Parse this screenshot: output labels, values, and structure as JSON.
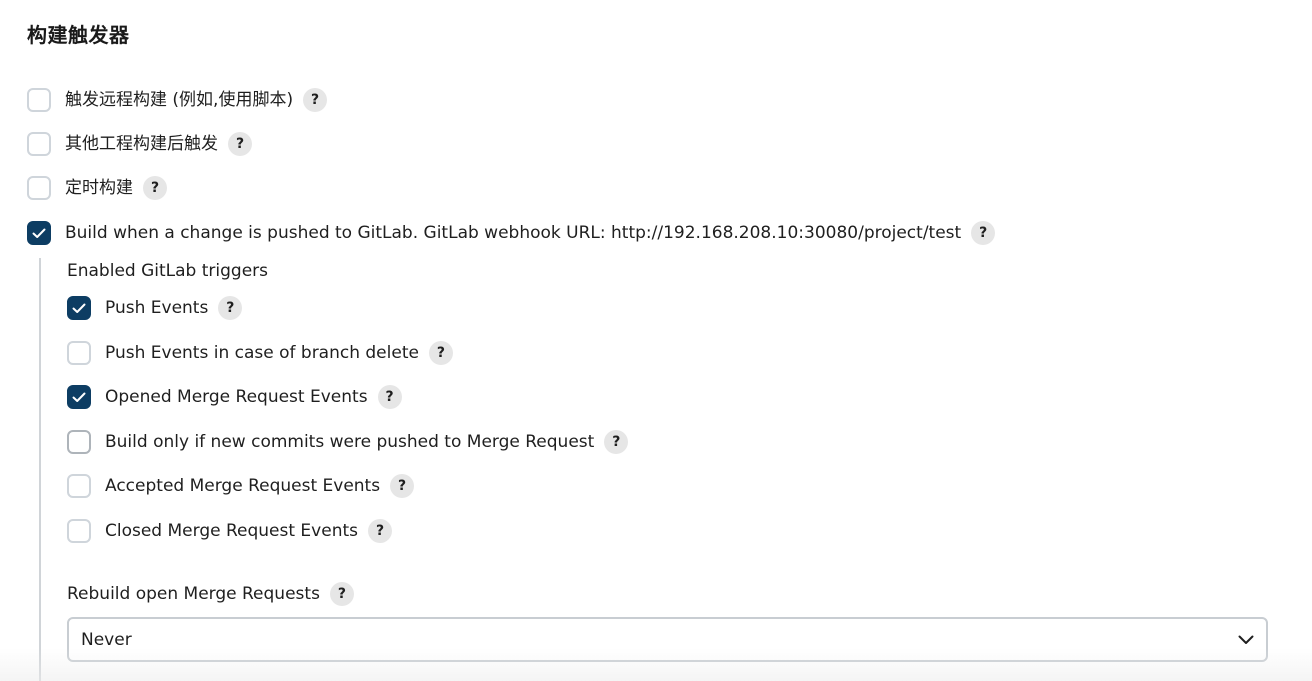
{
  "section": {
    "title": "构建触发器"
  },
  "triggers": [
    {
      "label": "触发远程构建 (例如,使用脚本)",
      "checked": false,
      "help": "?"
    },
    {
      "label": "其他工程构建后触发",
      "checked": false,
      "help": "?"
    },
    {
      "label": "定时构建",
      "checked": false,
      "help": "?"
    },
    {
      "label": "Build when a change is pushed to GitLab. GitLab webhook URL: http://192.168.208.10:30080/project/test",
      "checked": true,
      "help": "?"
    }
  ],
  "gitlab": {
    "heading": "Enabled GitLab triggers",
    "options": [
      {
        "label": "Push Events",
        "checked": true,
        "help": "?"
      },
      {
        "label": "Push Events in case of branch delete",
        "checked": false,
        "help": "?"
      },
      {
        "label": "Opened Merge Request Events",
        "checked": true,
        "help": "?"
      },
      {
        "label": "Build only if new commits were pushed to Merge Request",
        "checked": false,
        "help": "?"
      },
      {
        "label": "Accepted Merge Request Events",
        "checked": false,
        "help": "?"
      },
      {
        "label": "Closed Merge Request Events",
        "checked": false,
        "help": "?"
      }
    ],
    "rebuild": {
      "label": "Rebuild open Merge Requests",
      "help": "?",
      "selected": "Never"
    }
  },
  "colors": {
    "checked_fill": "#0d3d63",
    "unchecked_border": "#cfd5db",
    "help_bg": "#e6e6e6"
  },
  "icons": {
    "check": "checkmark-icon",
    "help": "question-mark-icon",
    "dropdown": "chevron-down-icon"
  }
}
